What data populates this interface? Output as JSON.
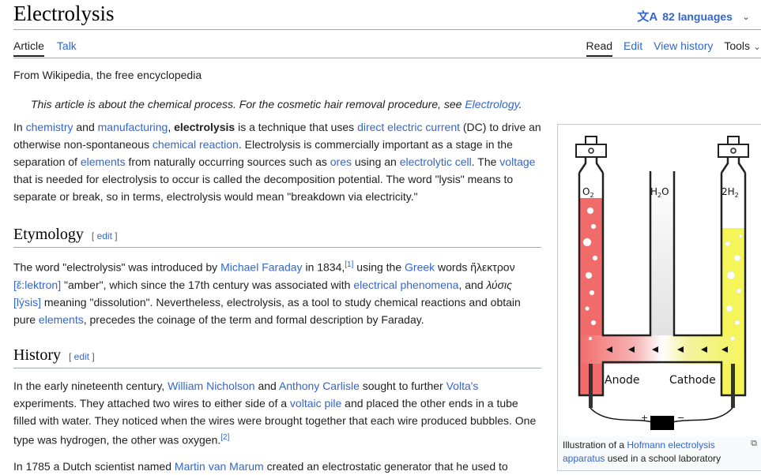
{
  "header": {
    "title": "Electrolysis",
    "languages": "82 languages"
  },
  "tabs": {
    "left": [
      "Article",
      "Talk"
    ],
    "right": [
      "Read",
      "Edit",
      "View history",
      "Tools"
    ]
  },
  "from": "From Wikipedia, the free encyclopedia",
  "hatnote": {
    "text": "This article is about the chemical process. For the cosmetic hair removal procedure, see ",
    "link": "Electrology",
    "end": "."
  },
  "intro": {
    "t1": "In ",
    "l1": "chemistry",
    "t2": " and ",
    "l2": "manufacturing",
    "t3": ", ",
    "b1": "electrolysis",
    "t4": " is a technique that uses ",
    "l3": "direct electric current",
    "t5": " (DC) to drive an otherwise non-spontaneous ",
    "l4": "chemical reaction",
    "t6": ". Electrolysis is commercially important as a stage in the separation of ",
    "l5": "elements",
    "t7": " from naturally occurring sources such as ",
    "l6": "ores",
    "t8": " using an ",
    "l7": "electrolytic cell",
    "t9": ". The ",
    "l8": "voltage",
    "t10": " that is needed for electrolysis to occur is called the decomposition potential. The word \"lysis\" means to separate or break, so in terms, electrolysis would mean \"breakdown via electricity.\""
  },
  "etymology": {
    "heading": "Etymology",
    "edit": "[ edit ]",
    "t1": "The word \"electrolysis\" was introduced by ",
    "l1": "Michael Faraday",
    "t2": " in 1834,",
    "ref": "[1]",
    "t3": " using the ",
    "l2": "Greek",
    "t4": " words ",
    "greek1": "ἤλεκτρον",
    "l3": "[ɛ̌:lektron]",
    "t5": " \"amber\", which since the 17th century was associated with ",
    "l4": "electrical phenomena",
    "t6": ", and ",
    "greek2": "λύσις",
    "l5": "[lýsis]",
    "t7": " meaning \"dissolution\". Nevertheless, electrolysis, as a tool to study chemical reactions and obtain pure ",
    "l6": "elements",
    "t8": ", precedes the coinage of the term and formal description by Faraday."
  },
  "history": {
    "heading": "History",
    "edit": "[ edit ]",
    "t1": "In the early nineteenth century, ",
    "l1": "William Nicholson",
    "t2": " and ",
    "l2": "Anthony Carlisle",
    "t3": " sought to further ",
    "l3": "Volta's",
    "t4": " experiments. They attached two wires to either side of a ",
    "l4": "voltaic pile",
    "t5": " and placed the other ends in a tube filled with water. They noticed when the wires were brought together that each wire produced bubbles. One type was hydrogen, the other was oxygen.",
    "ref": "[2]",
    "p2_t1": "In 1785 a Dutch scientist named ",
    "p2_l1": "Martin van Marum",
    "p2_t2": " created an electrostatic generator that he used to"
  },
  "infobox": {
    "labels": {
      "o2": "O",
      "o2_sub": "2",
      "h2o": "H",
      "h2o_sub": "2",
      "h2o_o": "O",
      "h2": "2H",
      "h2_sub": "2",
      "anode": "Anode",
      "cathode": "Cathode",
      "plus": "+",
      "minus": "−"
    },
    "caption_t1": "Illustration of a ",
    "caption_link": "Hofmann electrolysis apparatus",
    "caption_t2": " used in a school laboratory"
  },
  "colors": {
    "link": "#3366cc",
    "oxygen": "#f26b6b",
    "hydrogen": "#f5f55a"
  }
}
